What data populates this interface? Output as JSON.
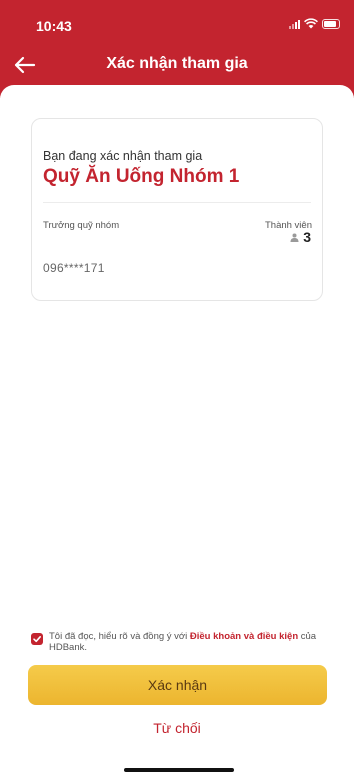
{
  "status_bar": {
    "time": "10:43"
  },
  "nav": {
    "title": "Xác nhận tham gia",
    "back_icon": "arrow-left-icon"
  },
  "card": {
    "intro": "Bạn đang xác nhận tham gia",
    "fund_name": "Quỹ Ăn Uống Nhóm 1",
    "leader_label": "Trưởng quỹ nhóm",
    "member_label": "Thành viên",
    "member_count": "3",
    "leader_phone": "096****171"
  },
  "agreement": {
    "checked": true,
    "text_before": "Tôi đã đọc, hiểu rõ và đồng ý với ",
    "link_text": "Điều khoản và điều kiện",
    "text_after": " của HDBank."
  },
  "actions": {
    "confirm_label": "Xác nhận",
    "reject_label": "Từ chối"
  },
  "colors": {
    "brand_red": "#c3242f",
    "button_yellow": "#f0be3a"
  }
}
